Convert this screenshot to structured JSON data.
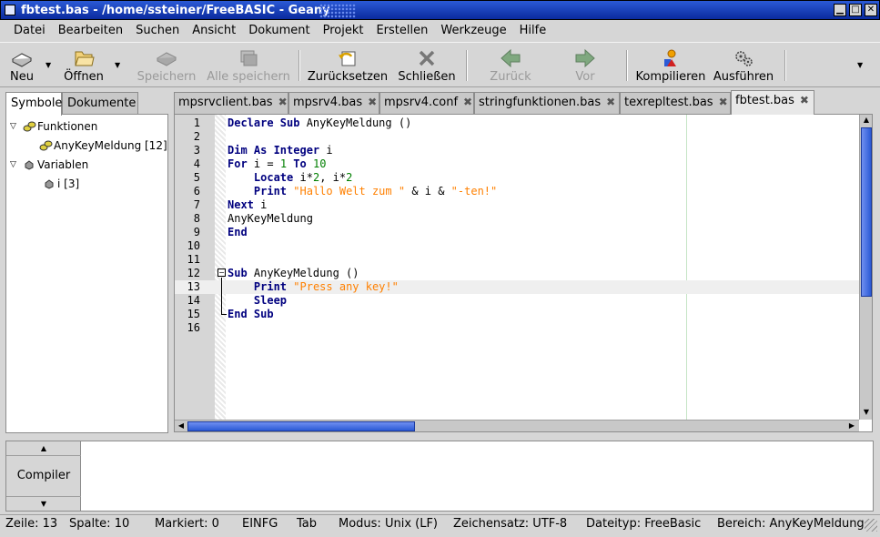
{
  "window": {
    "title": "fbtest.bas - /home/ssteiner/FreeBASIC - Geany"
  },
  "menu": [
    "Datei",
    "Bearbeiten",
    "Suchen",
    "Ansicht",
    "Dokument",
    "Projekt",
    "Erstellen",
    "Werkzeuge",
    "Hilfe"
  ],
  "toolbar": {
    "neu": "Neu",
    "oeffnen": "Öffnen",
    "speichern": "Speichern",
    "alle_speichern": "Alle speichern",
    "zuruecksetzen": "Zurücksetzen",
    "schliessen": "Schließen",
    "zurueck": "Zurück",
    "vor": "Vor",
    "kompilieren": "Kompilieren",
    "ausfuehren": "Ausführen"
  },
  "sidebar": {
    "tabs": [
      "Symbole",
      "Dokumente"
    ],
    "tree": [
      {
        "label": "Funktionen"
      },
      {
        "label": "AnyKeyMeldung [12]"
      },
      {
        "label": "Variablen"
      },
      {
        "label": "i [3]"
      }
    ]
  },
  "editor_tabs": [
    "mpsrvclient.bas",
    "mpsrv4.bas",
    "mpsrv4.conf",
    "stringfunktionen.bas",
    "texrepltest.bas",
    "fbtest.bas"
  ],
  "editor": {
    "line_numbers": [
      "1",
      "2",
      "3",
      "4",
      "5",
      "6",
      "7",
      "8",
      "9",
      "10",
      "11",
      "12",
      "13",
      "14",
      "15",
      "16"
    ],
    "lines": [
      [
        {
          "t": "kw",
          "v": "Declare Sub"
        },
        {
          "t": "",
          "v": " AnyKeyMeldung ()"
        }
      ],
      [],
      [
        {
          "t": "kw",
          "v": "Dim As Integer"
        },
        {
          "t": "",
          "v": " i"
        }
      ],
      [
        {
          "t": "kw",
          "v": "For"
        },
        {
          "t": "",
          "v": " i = "
        },
        {
          "t": "num",
          "v": "1"
        },
        {
          "t": "",
          "v": " "
        },
        {
          "t": "kw",
          "v": "To"
        },
        {
          "t": "",
          "v": " "
        },
        {
          "t": "num",
          "v": "10"
        }
      ],
      [
        {
          "t": "",
          "v": "    "
        },
        {
          "t": "kw",
          "v": "Locate"
        },
        {
          "t": "",
          "v": " i*"
        },
        {
          "t": "num",
          "v": "2"
        },
        {
          "t": "",
          "v": ", i*"
        },
        {
          "t": "num",
          "v": "2"
        }
      ],
      [
        {
          "t": "",
          "v": "    "
        },
        {
          "t": "kw",
          "v": "Print"
        },
        {
          "t": "",
          "v": " "
        },
        {
          "t": "str",
          "v": "\"Hallo Welt zum \""
        },
        {
          "t": "",
          "v": " & i & "
        },
        {
          "t": "str",
          "v": "\"-ten!\""
        }
      ],
      [
        {
          "t": "kw",
          "v": "Next"
        },
        {
          "t": "",
          "v": " i"
        }
      ],
      [
        {
          "t": "",
          "v": "AnyKeyMeldung"
        }
      ],
      [
        {
          "t": "kw",
          "v": "End"
        }
      ],
      [],
      [],
      [
        {
          "t": "kw",
          "v": "Sub"
        },
        {
          "t": "",
          "v": " AnyKeyMeldung ()"
        }
      ],
      [
        {
          "t": "",
          "v": "    "
        },
        {
          "t": "kw",
          "v": "Print"
        },
        {
          "t": "",
          "v": " "
        },
        {
          "t": "str",
          "v": "\"Press any key!\""
        }
      ],
      [
        {
          "t": "",
          "v": "    "
        },
        {
          "t": "kw",
          "v": "Sleep"
        }
      ],
      [
        {
          "t": "kw",
          "v": "End Sub"
        }
      ],
      []
    ]
  },
  "message_panel": {
    "tab": "Compiler"
  },
  "status": {
    "zeile": "Zeile: 13",
    "spalte": "Spalte: 10",
    "markiert": "Markiert: 0",
    "mode": "EINFG",
    "indent": "Tab",
    "modus": "Modus: Unix (LF)",
    "zeichensatz": "Zeichensatz: UTF-8",
    "dateityp": "Dateityp: FreeBasic",
    "bereich": "Bereich: AnyKeyMeldung"
  }
}
